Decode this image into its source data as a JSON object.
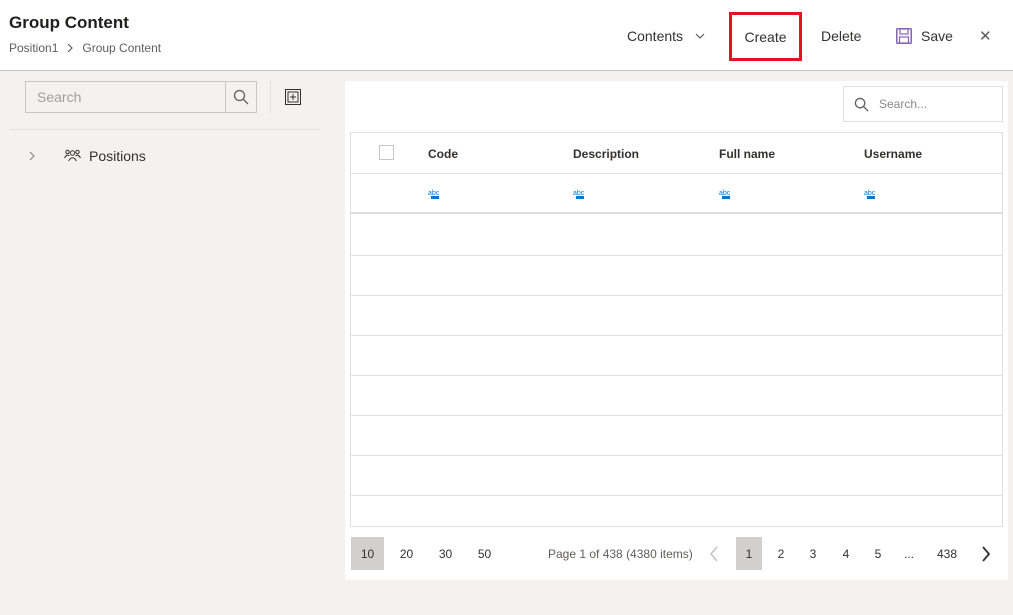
{
  "header": {
    "title": "Group Content",
    "breadcrumb": [
      "Position1",
      "Group Content"
    ]
  },
  "toolbar": {
    "contents_label": "Contents",
    "create_label": "Create",
    "delete_label": "Delete",
    "save_label": "Save",
    "close_glyph": "✕",
    "highlight_color": "#e81123"
  },
  "sidebar": {
    "search_placeholder": "Search",
    "tree": [
      {
        "label": "Positions",
        "icon": "people-icon"
      }
    ]
  },
  "grid": {
    "search_placeholder": "Search...",
    "columns": [
      "Code",
      "Description",
      "Full name",
      "Username"
    ],
    "filter_icon": "text-filter-icon"
  },
  "pager": {
    "page_sizes": [
      "10",
      "20",
      "30",
      "50"
    ],
    "selected_page_size": "10",
    "info": "Page 1 of 438 (4380 items)",
    "pages": [
      "1",
      "2",
      "3",
      "4",
      "5"
    ],
    "ellipsis": "...",
    "last_page": "438",
    "current_page": "1"
  },
  "colors": {
    "accent": "#0078d4",
    "save_icon": "#8764b8"
  }
}
